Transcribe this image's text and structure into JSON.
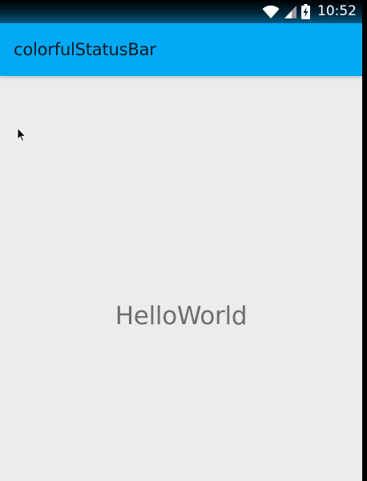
{
  "status_bar": {
    "time": "10:52",
    "icons": [
      "wifi-icon",
      "cell-signal-icon",
      "battery-charging-icon"
    ]
  },
  "app_bar": {
    "title": "colorfulStatusBar",
    "color": "#03a9f4"
  },
  "content": {
    "text": "HelloWorld",
    "background": "#ececec"
  }
}
